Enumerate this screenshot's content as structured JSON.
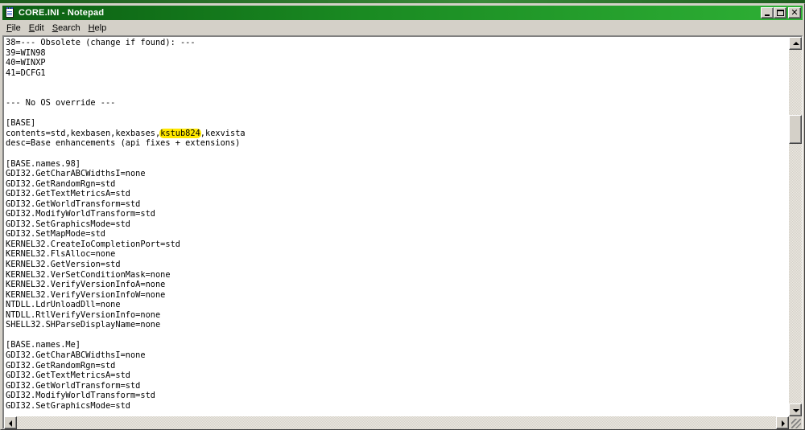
{
  "window": {
    "title": "CORE.INI - Notepad"
  },
  "menu": [
    {
      "label": "File",
      "accel": "F",
      "rest": "ile"
    },
    {
      "label": "Edit",
      "accel": "E",
      "rest": "dit"
    },
    {
      "label": "Search",
      "accel": "S",
      "rest": "earch"
    },
    {
      "label": "Help",
      "accel": "H",
      "rest": "elp"
    }
  ],
  "editor": {
    "lines": [
      "38=--- Obsolete (change if found): ---",
      "39=WIN98",
      "40=WINXP",
      "41=DCFG1",
      "",
      "",
      "--- No OS override ---",
      "",
      "[BASE]",
      "contents=std,kexbasen,kexbases,kstub824,kexvista",
      "desc=Base enhancements (api fixes + extensions)",
      "",
      "[BASE.names.98]",
      "GDI32.GetCharABCWidthsI=none",
      "GDI32.GetRandomRgn=std",
      "GDI32.GetTextMetricsA=std",
      "GDI32.GetWorldTransform=std",
      "GDI32.ModifyWorldTransform=std",
      "GDI32.SetGraphicsMode=std",
      "GDI32.SetMapMode=std",
      "KERNEL32.CreateIoCompletionPort=std",
      "KERNEL32.FlsAlloc=none",
      "KERNEL32.GetVersion=std",
      "KERNEL32.VerSetConditionMask=none",
      "KERNEL32.VerifyVersionInfoA=none",
      "KERNEL32.VerifyVersionInfoW=none",
      "NTDLL.LdrUnloadDll=none",
      "NTDLL.RtlVerifyVersionInfo=none",
      "SHELL32.SHParseDisplayName=none",
      "",
      "[BASE.names.Me]",
      "GDI32.GetCharABCWidthsI=none",
      "GDI32.GetRandomRgn=std",
      "GDI32.GetTextMetricsA=std",
      "GDI32.GetWorldTransform=std",
      "GDI32.ModifyWorldTransform=std",
      "GDI32.SetGraphicsMode=std"
    ],
    "highlight": {
      "line": 9,
      "text": "kstub824",
      "color": "#ffe800"
    }
  },
  "scrollbars": {
    "vertical_position": 0.2,
    "horizontal_position": 0.0
  },
  "colors": {
    "titlebar_start": "#0b5e12",
    "titlebar_end": "#2eb035",
    "face": "#d4d0c8",
    "highlight": "#ffe800"
  },
  "icons": {
    "app": "notepad-icon",
    "minimize": "minimize-icon",
    "maximize": "maximize-icon",
    "close": "close-icon"
  }
}
